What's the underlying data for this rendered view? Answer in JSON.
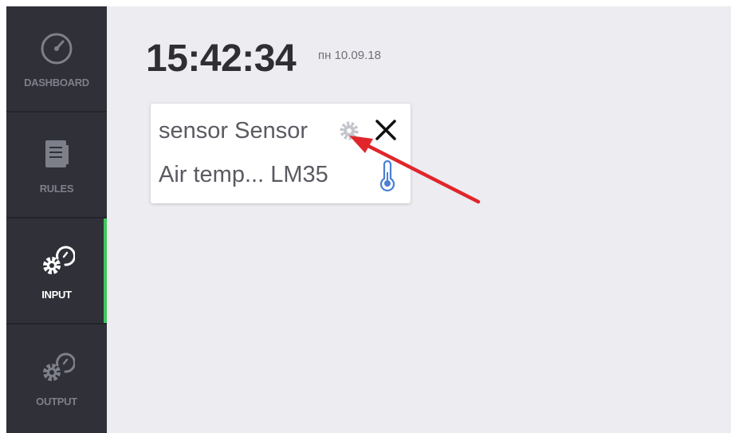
{
  "sidebar": {
    "items": [
      {
        "label": "DASHBOARD",
        "icon": "speedometer-icon",
        "active": false
      },
      {
        "label": "RULES",
        "icon": "document-icon",
        "active": false
      },
      {
        "label": "INPUT",
        "icon": "gear-gauge-icon",
        "active": true
      },
      {
        "label": "OUTPUT",
        "icon": "gear-gauge-icon",
        "active": false
      }
    ]
  },
  "header": {
    "time": "15:42:34",
    "date": "пн 10.09.18"
  },
  "sensor_card": {
    "title": "sensor Sensor",
    "subtitle": "Air temp... LM35",
    "settings_icon": "gear-icon",
    "close_icon": "close-icon",
    "type_icon": "thermometer-icon"
  },
  "colors": {
    "sidebar_bg": "#2f3038",
    "content_bg": "#ececf1",
    "active_accent": "#3fc85a",
    "annotation_arrow": "#e0262b",
    "thermometer": "#4a7fd4"
  }
}
